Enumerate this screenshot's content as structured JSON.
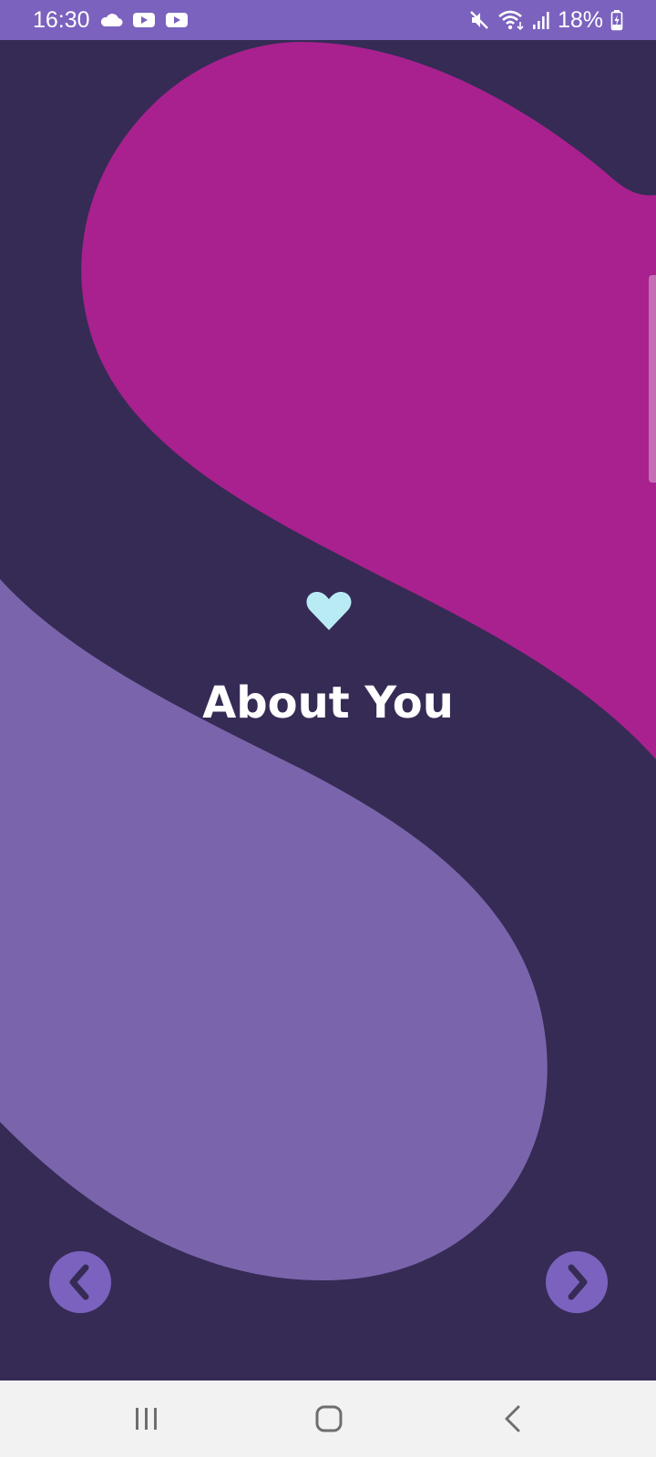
{
  "status_bar": {
    "time": "16:30",
    "battery": "18%",
    "left_icons": [
      "cloud-icon",
      "youtube-icon",
      "youtube-icon"
    ],
    "right_icons": [
      "mute-icon",
      "wifi-icon",
      "signal-icon",
      "battery-charging-icon"
    ],
    "background_color": "#7b62be"
  },
  "main": {
    "icon": "heart-icon",
    "title": "About You",
    "background_color": "#352b55",
    "blob_colors": {
      "magenta": "#a8218e",
      "lavender": "#7a65ac"
    },
    "icon_color": "#b9ebf5"
  },
  "navigation": {
    "prev_icon": "chevron-left-icon",
    "next_icon": "chevron-right-icon",
    "button_color": "#7b62be"
  },
  "system_nav": {
    "recents_icon": "recents-icon",
    "home_icon": "home-icon",
    "back_icon": "back-icon"
  }
}
